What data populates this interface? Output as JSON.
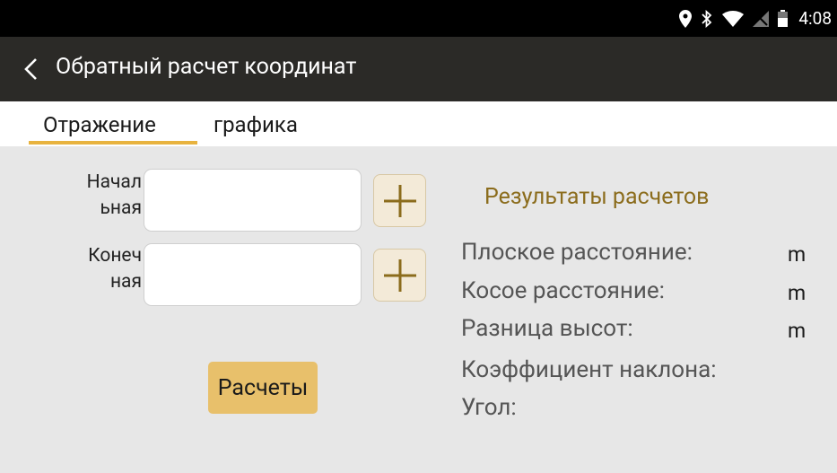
{
  "status_bar": {
    "time": "4:08",
    "icons": [
      "location-icon",
      "bluetooth-icon",
      "wifi-icon",
      "no-signal-icon",
      "battery-icon"
    ]
  },
  "app_bar": {
    "title": "Обратный расчет координат",
    "back_icon": "chevron-left-icon"
  },
  "tabs": [
    {
      "label": "Отражение",
      "active": true
    },
    {
      "label": "графика",
      "active": false
    }
  ],
  "form": {
    "start_label_line1": "Начал",
    "start_label_line2": "ьная",
    "start_value": "",
    "end_label_line1": "Конеч",
    "end_label_line2": "ная",
    "end_value": "",
    "add_icon": "plus-icon",
    "calculate_label": "Расчеты"
  },
  "results": {
    "title": "Результаты расчетов",
    "items": [
      {
        "label": "Плоское расстояние:",
        "unit": "m"
      },
      {
        "label": "Косое расстояние:",
        "unit": "m"
      },
      {
        "label": "Разница высот:",
        "unit": "m"
      },
      {
        "label": "Коэффициент наклона:",
        "unit": ""
      },
      {
        "label": "Угол:",
        "unit": ""
      }
    ]
  },
  "colors": {
    "accent": "#e8b33f",
    "button": "#e8c06b",
    "results_title": "#8b6c1c",
    "app_bar": "#2b2a27",
    "panel": "#e7e7e7"
  }
}
